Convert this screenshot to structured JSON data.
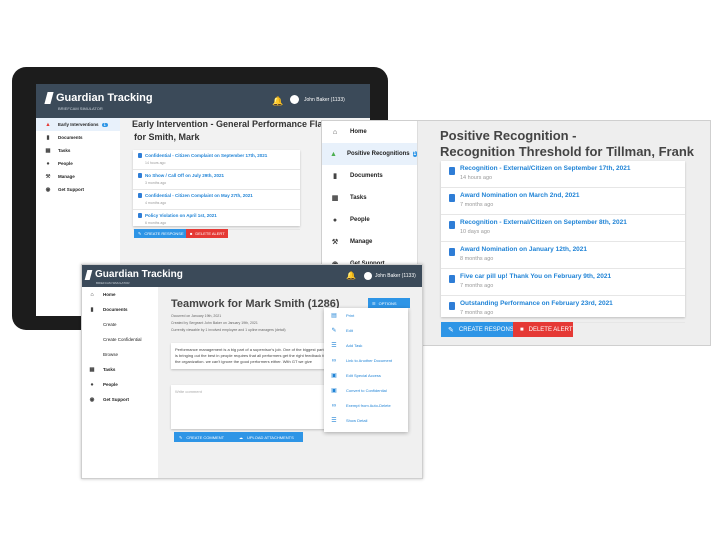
{
  "brand": {
    "name": "Guardian Tracking",
    "tagline": "BRIEFCAM SIMULATOR"
  },
  "user": {
    "name": "John Baker (1133)"
  },
  "tablet": {
    "sidebar": [
      {
        "label": "Early Interventions",
        "icon": "warning-icon",
        "badge": "1"
      },
      {
        "label": "Documents",
        "icon": "document-icon"
      },
      {
        "label": "Tasks",
        "icon": "calendar-icon"
      },
      {
        "label": "People",
        "icon": "people-icon"
      },
      {
        "label": "Manage",
        "icon": "wrench-icon"
      },
      {
        "label": "Get Support",
        "icon": "help-icon"
      }
    ],
    "title_line1": "Early Intervention - General Performance Flag",
    "title_line2": "for Smith, Mark",
    "items": [
      {
        "title": "Confidential - Citizen Complaint on September 17th, 2021",
        "ago": "14 hours ago"
      },
      {
        "title": "No Show / Call Off on July 29th, 2021",
        "ago": "3 months ago"
      },
      {
        "title": "Confidential - Citizen Complaint on May 27th, 2021",
        "ago": "4 months ago"
      },
      {
        "title": "Policy Violation on April 1st, 2021",
        "ago": "6 months ago"
      }
    ],
    "create_label": "CREATE RESPONSE",
    "delete_label": "DELETE ALERT"
  },
  "right": {
    "sidebar": [
      {
        "label": "Home",
        "icon": "home-icon"
      },
      {
        "label": "Positive Recognitions",
        "icon": "thumbs-up-icon",
        "badge": "1"
      },
      {
        "label": "Documents",
        "icon": "document-icon"
      },
      {
        "label": "Tasks",
        "icon": "calendar-icon"
      },
      {
        "label": "People",
        "icon": "people-icon"
      },
      {
        "label": "Manage",
        "icon": "wrench-icon"
      },
      {
        "label": "Get Support",
        "icon": "help-icon"
      }
    ],
    "title_line1": "Positive Recognition -",
    "title_line2": "Recognition Threshold for Tillman, Frank",
    "items": [
      {
        "title": "Recognition - External/Citizen on September 17th, 2021",
        "ago": "14 hours ago"
      },
      {
        "title": "Award Nomination on March 2nd, 2021",
        "ago": "7 months ago"
      },
      {
        "title": "Recognition - External/Citizen on September 8th, 2021",
        "ago": "10 days ago"
      },
      {
        "title": "Award Nomination on January 12th, 2021",
        "ago": "8 months ago"
      },
      {
        "title": "Five car pill up! Thank You on February 9th, 2021",
        "ago": "7 months ago"
      },
      {
        "title": "Outstanding Performance on February 23rd, 2021",
        "ago": "7 months ago"
      }
    ],
    "create_label": "CREATE RESPONSE",
    "delete_label": "DELETE ALERT"
  },
  "front": {
    "sidebar": [
      {
        "label": "Home",
        "icon": "home-icon",
        "bold": true
      },
      {
        "label": "Documents",
        "icon": "document-icon",
        "bold": true
      },
      {
        "label": "Create",
        "icon": ""
      },
      {
        "label": "Create Confidential",
        "icon": ""
      },
      {
        "label": "Browse",
        "icon": ""
      },
      {
        "label": "Tasks",
        "icon": "calendar-icon",
        "bold": true
      },
      {
        "label": "People",
        "icon": "people-icon",
        "bold": true
      },
      {
        "label": "Get Support",
        "icon": "help-icon",
        "bold": true
      }
    ],
    "title": "Teamwork for Mark Smith (1286)",
    "options_label": "OPTIONS",
    "meta": [
      "Occurred on January 19th, 2021",
      "Created by Sergeant John Baker on January 19th, 2021",
      "Currently viewable by 1 involved employee and 1 upline managers (detail)"
    ],
    "body": "Performance management is a big part of a supervisor's job. One of the biggest parts is bringing out the best in people requires that all performers get the right feedback for the organization. we can't ignore the good performers either. With GT we give",
    "comment_placeholder": "Write comment",
    "create_comment_label": "CREATE COMMENT",
    "upload_label": "UPLOAD ATTACHMENTS",
    "menu": [
      {
        "label": "Print",
        "icon": "print-icon"
      },
      {
        "label": "Edit",
        "icon": "edit-icon"
      },
      {
        "label": "Add Task",
        "icon": "task-icon"
      },
      {
        "label": "Link to Another Document",
        "icon": "link-icon"
      },
      {
        "label": "Edit Special Access",
        "icon": "lock-icon"
      },
      {
        "label": "Convert to Confidential",
        "icon": "lock-icon"
      },
      {
        "label": "Exempt from Auto-Delete",
        "icon": "link-icon"
      },
      {
        "label": "Show Detail",
        "icon": "list-icon"
      }
    ]
  }
}
